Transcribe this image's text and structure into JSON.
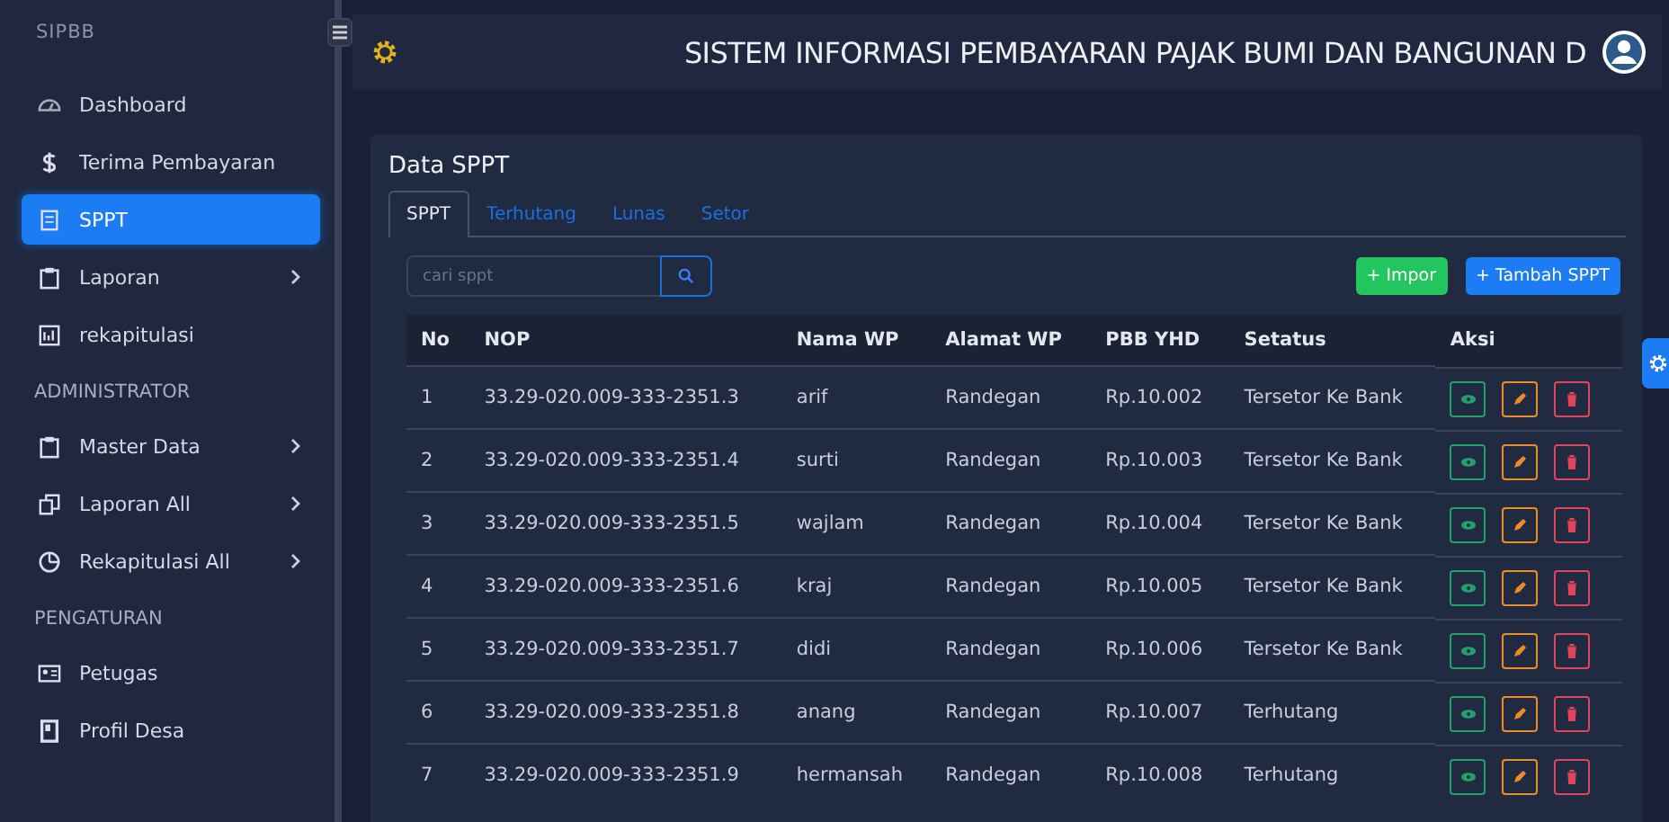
{
  "sidebar": {
    "brand": "SIPBB",
    "items": [
      {
        "kind": "item",
        "label": "Dashboard",
        "selected": false,
        "expandable": false
      },
      {
        "kind": "item",
        "label": "Terima Pembayaran",
        "selected": false,
        "expandable": false
      },
      {
        "kind": "item",
        "label": "SPPT",
        "selected": true,
        "expandable": false
      },
      {
        "kind": "item",
        "label": "Laporan",
        "selected": false,
        "expandable": true
      },
      {
        "kind": "item",
        "label": "rekapitulasi",
        "selected": false,
        "expandable": false
      },
      {
        "kind": "heading",
        "label": "ADMINISTRATOR"
      },
      {
        "kind": "item",
        "label": "Master Data",
        "selected": false,
        "expandable": true
      },
      {
        "kind": "item",
        "label": "Laporan All",
        "selected": false,
        "expandable": true
      },
      {
        "kind": "item",
        "label": "Rekapitulasi All",
        "selected": false,
        "expandable": true
      },
      {
        "kind": "heading",
        "label": "PENGATURAN"
      },
      {
        "kind": "item",
        "label": "Petugas",
        "selected": false,
        "expandable": false
      },
      {
        "kind": "item",
        "label": "Profil Desa",
        "selected": false,
        "expandable": false
      }
    ]
  },
  "header": {
    "title": "SISTEM INFORMASI PEMBAYARAN PAJAK BUMI DAN BANGUNAN D"
  },
  "card": {
    "title": "Data SPPT",
    "tabs": [
      {
        "label": "SPPT",
        "selected": true
      },
      {
        "label": "Terhutang",
        "selected": false
      },
      {
        "label": "Lunas",
        "selected": false
      },
      {
        "label": "Setor",
        "selected": false
      }
    ],
    "search": {
      "placeholder": "cari sppt"
    },
    "buttons": [
      {
        "kind": "success",
        "label": "+ Impor"
      },
      {
        "kind": "primary",
        "label": "+ Tambah SPPT"
      }
    ],
    "table": {
      "columns": [
        "No",
        "NOP",
        "Nama WP",
        "Alamat WP",
        "PBB YHD",
        "Setatus",
        "Aksi"
      ],
      "rows": [
        [
          "1",
          "33.29-020.009-333-2351.3",
          "arif",
          "Randegan",
          "Rp.10.002",
          "Tersetor Ke Bank"
        ],
        [
          "2",
          "33.29-020.009-333-2351.4",
          "surti",
          "Randegan",
          "Rp.10.003",
          "Tersetor Ke Bank"
        ],
        [
          "3",
          "33.29-020.009-333-2351.5",
          "wajlam",
          "Randegan",
          "Rp.10.004",
          "Tersetor Ke Bank"
        ],
        [
          "4",
          "33.29-020.009-333-2351.6",
          "kraj",
          "Randegan",
          "Rp.10.005",
          "Tersetor Ke Bank"
        ],
        [
          "5",
          "33.29-020.009-333-2351.7",
          "didi",
          "Randegan",
          "Rp.10.006",
          "Tersetor Ke Bank"
        ],
        [
          "6",
          "33.29-020.009-333-2351.8",
          "anang",
          "Randegan",
          "Rp.10.007",
          "Terhutang"
        ],
        [
          "7",
          "33.29-020.009-333-2351.9",
          "hermansah",
          "Randegan",
          "Rp.10.008",
          "Terhutang"
        ]
      ]
    }
  }
}
